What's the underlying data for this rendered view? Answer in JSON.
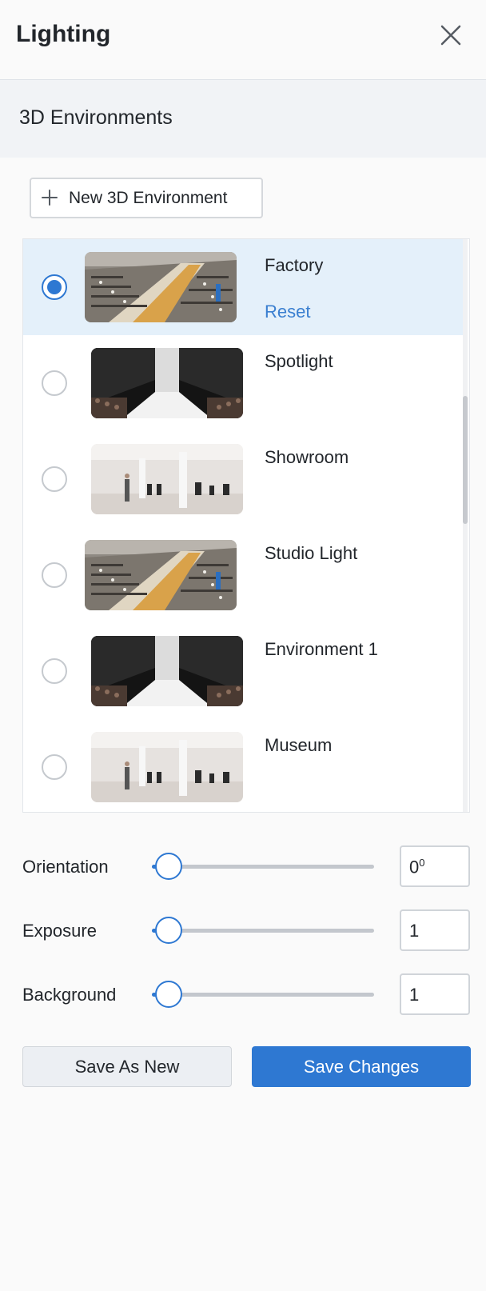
{
  "header": {
    "title": "Lighting",
    "close_icon": "close-icon"
  },
  "section": {
    "title": "3D Environments"
  },
  "new_environment": {
    "icon": "plus-icon",
    "label": "New 3D Environment"
  },
  "environments": [
    {
      "name": "Factory",
      "thumbnail": "factory",
      "selected": true,
      "reset_label": "Reset"
    },
    {
      "name": "Spotlight",
      "thumbnail": "runway",
      "selected": false
    },
    {
      "name": "Showroom",
      "thumbnail": "showroom",
      "selected": false
    },
    {
      "name": "Studio Light",
      "thumbnail": "factory",
      "selected": false
    },
    {
      "name": "Environment 1",
      "thumbnail": "runway",
      "selected": false
    },
    {
      "name": "Museum",
      "thumbnail": "showroom",
      "selected": false
    }
  ],
  "controls": {
    "orientation": {
      "label": "Orientation",
      "value": "0",
      "unit": "0"
    },
    "exposure": {
      "label": "Exposure",
      "value": "1"
    },
    "background": {
      "label": "Background",
      "value": "1"
    }
  },
  "footer": {
    "save_as_new": "Save As New",
    "save_changes": "Save Changes"
  },
  "colors": {
    "accent": "#2e78d2",
    "selected_row": "#e4f0fa",
    "link": "#3a7fd0"
  }
}
